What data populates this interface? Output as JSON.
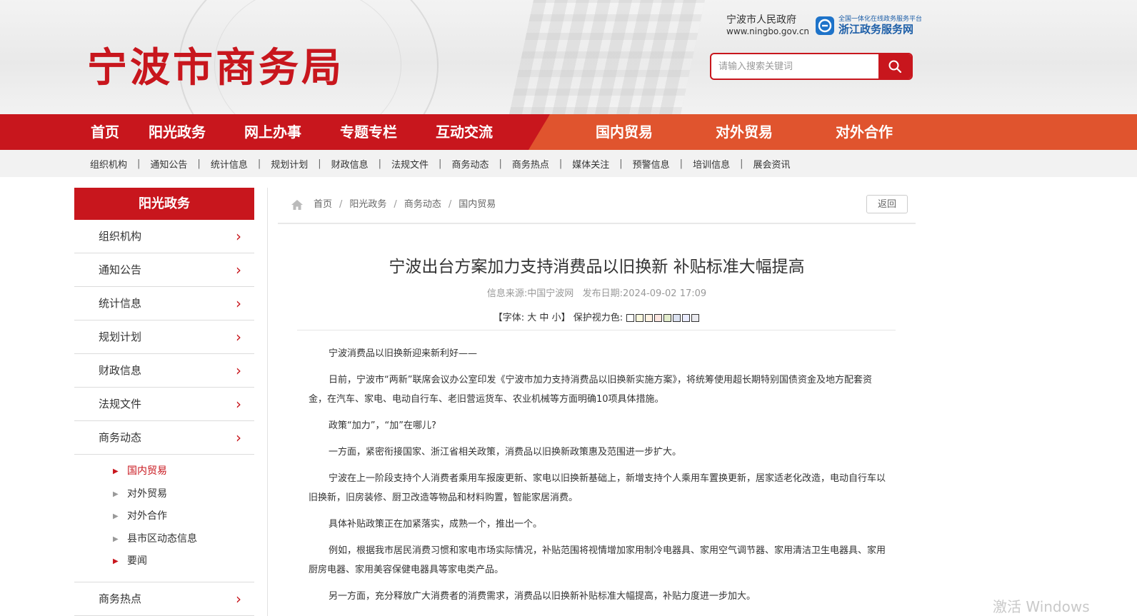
{
  "header": {
    "site_title": "宁波市商务局",
    "gov_link": {
      "name": "宁波市人民政府",
      "url_text": "www.ningbo.gov.cn"
    },
    "zj_link": {
      "tagline": "全国一体化在线政务服务平台",
      "name": "浙江政务服务网"
    },
    "search": {
      "placeholder": "请输入搜索关键词"
    }
  },
  "main_nav": [
    "首页",
    "阳光政务",
    "网上办事",
    "专题专栏",
    "互动交流",
    "国内贸易",
    "对外贸易",
    "对外合作"
  ],
  "sub_nav": [
    "组织机构",
    "通知公告",
    "统计信息",
    "规划计划",
    "财政信息",
    "法规文件",
    "商务动态",
    "商务热点",
    "媒体关注",
    "预警信息",
    "培训信息",
    "展会资讯"
  ],
  "sidebar": {
    "title": "阳光政务",
    "items": [
      "组织机构",
      "通知公告",
      "统计信息",
      "规划计划",
      "财政信息",
      "法规文件",
      "商务动态"
    ],
    "sub_items": [
      "国内贸易",
      "对外贸易",
      "对外合作",
      "县市区动态信息",
      "要闻"
    ],
    "after_items": [
      "商务热点"
    ],
    "active_sub": "国内贸易"
  },
  "breadcrumb": {
    "items": [
      "首页",
      "阳光政务",
      "商务动态",
      "国内贸易"
    ],
    "back": "返回"
  },
  "article": {
    "title": "宁波出台方案加力支持消费品以旧换新 补贴标准大幅提高",
    "source_label": "信息来源:",
    "source": "中国宁波网",
    "date_label": "发布日期:",
    "date": "2024-09-02 17:09",
    "tools": {
      "font_label": "【字体:",
      "large": "大",
      "medium": "中",
      "small": "小",
      "close": "】",
      "eye_label": "保护视力色:"
    },
    "paragraphs": [
      "宁波消费品以旧换新迎来新利好——",
      "日前，宁波市“两新”联席会议办公室印发《宁波市加力支持消费品以旧换新实施方案》，将统筹使用超长期特别国债资金及地方配套资金，在汽车、家电、电动自行车、老旧营运货车、农业机械等方面明确10项具体措施。",
      "政策“加力”，“加”在哪儿?",
      "一方面，紧密衔接国家、浙江省相关政策，消费品以旧换新政策惠及范围进一步扩大。",
      "宁波在上一阶段支持个人消费者乘用车报废更新、家电以旧换新基础上，新增支持个人乘用车置换更新，居家适老化改造，电动自行车以旧换新，旧房装修、厨卫改造等物品和材料购置，智能家居消费。",
      "具体补贴政策正在加紧落实，成熟一个，推出一个。",
      "例如，根据我市居民消费习惯和家电市场实际情况，补贴范围将视情增加家用制冷电器具、家用空气调节器、家用清洁卫生电器具、家用厨房电器、家用美容保健电器具等家电类产品。",
      "另一方面，充分释放广大消费者的消费需求，消费品以旧换新补贴标准大幅提高，补贴力度进一步加大。"
    ]
  },
  "swatch_colors": [
    "#ffffff",
    "#faf9de",
    "#fff2e2",
    "#fde6e0",
    "#e3edcd",
    "#dce2f1",
    "#e9ebfe",
    "#eaeaef"
  ],
  "colors": {
    "brand_red": "#c8161d",
    "nav_orange": "#e0542e"
  },
  "watermark": "激活 Windows"
}
